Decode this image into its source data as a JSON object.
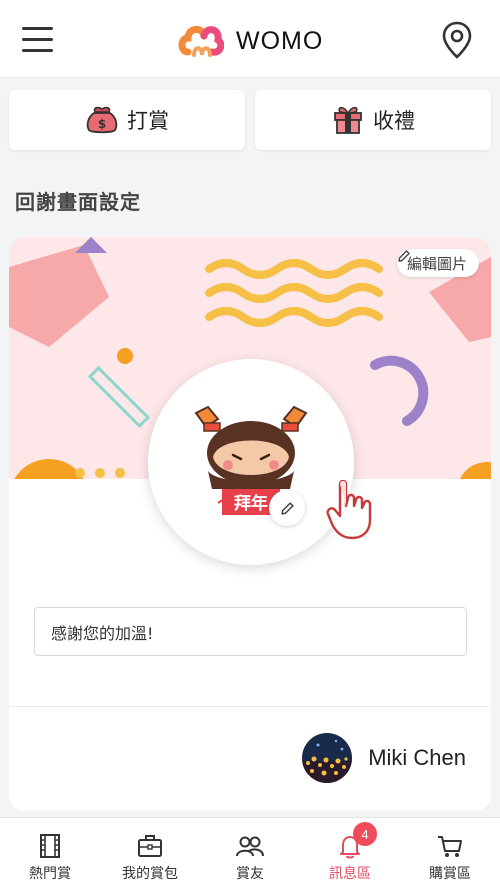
{
  "header": {
    "app_name": "WOMO"
  },
  "actions": {
    "tip_label": "打賞",
    "gift_label": "收禮"
  },
  "section": {
    "title": "回謝畫面設定"
  },
  "card": {
    "edit_image_label": "編輯圖片",
    "message_value": "感謝您的加溫!",
    "user_name": "Miki Chen"
  },
  "nav": {
    "items": [
      {
        "label": "熱門賞",
        "icon": "film-icon"
      },
      {
        "label": "我的賞包",
        "icon": "briefcase-icon"
      },
      {
        "label": "賞友",
        "icon": "friends-icon"
      },
      {
        "label": "訊息區",
        "icon": "bell-icon",
        "badge": "4"
      },
      {
        "label": "購賞區",
        "icon": "cart-icon"
      }
    ],
    "active_index": 3
  },
  "colors": {
    "accent": "#e34d62",
    "badge": "#ef4b5d",
    "banner_bg": "#fde7e8",
    "logo_orange": "#f28a3a",
    "logo_pink": "#ea4c7c"
  }
}
